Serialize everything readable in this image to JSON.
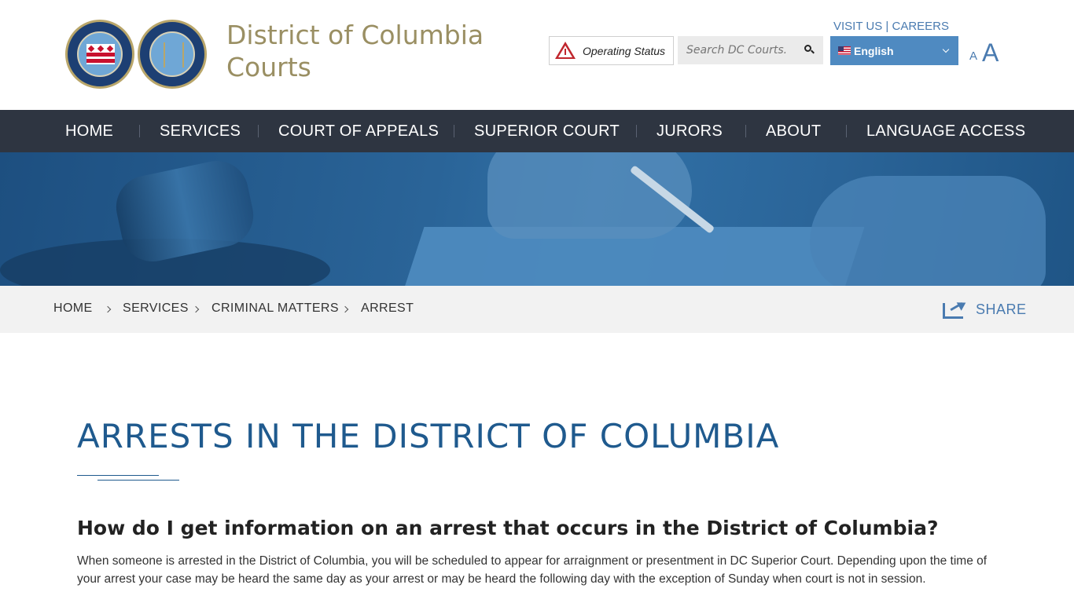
{
  "header": {
    "site_title": "District of Columbia Courts",
    "top_links": {
      "visit_us": "VISIT US",
      "divider": "|",
      "careers": "CAREERS"
    },
    "operating_status": "Operating Status",
    "search": {
      "placeholder": "Search DC Courts."
    },
    "language": {
      "selected": "English"
    },
    "font_size": {
      "small": "A",
      "large": "A"
    }
  },
  "nav": {
    "items": [
      "HOME",
      "SERVICES",
      "COURT OF APPEALS",
      "SUPERIOR COURT",
      "JURORS",
      "ABOUT",
      "LANGUAGE ACCESS"
    ]
  },
  "breadcrumb": {
    "items": [
      "HOME",
      "SERVICES",
      "CRIMINAL MATTERS",
      "ARREST"
    ],
    "share": "SHARE"
  },
  "main": {
    "title": "ARRESTS IN THE DISTRICT OF COLUMBIA",
    "question": "How do I get information on an arrest that occurs in the District of Columbia?",
    "paragraph": "When someone is arrested in the District of Columbia, you will be scheduled to appear for arraignment or presentment in DC Superior Court. Depending upon the time of your arrest your case may be heard the same day as your arrest or may be heard the following day with the exception of Sunday when court is not in session."
  },
  "colors": {
    "nav_bg": "#2e3541",
    "accent_blue": "#4a7bb0",
    "title_blue": "#1f5a8e",
    "brand_gold": "#9a8f63",
    "language_bg": "#4f8ac1",
    "alert_red": "#c0262d"
  }
}
